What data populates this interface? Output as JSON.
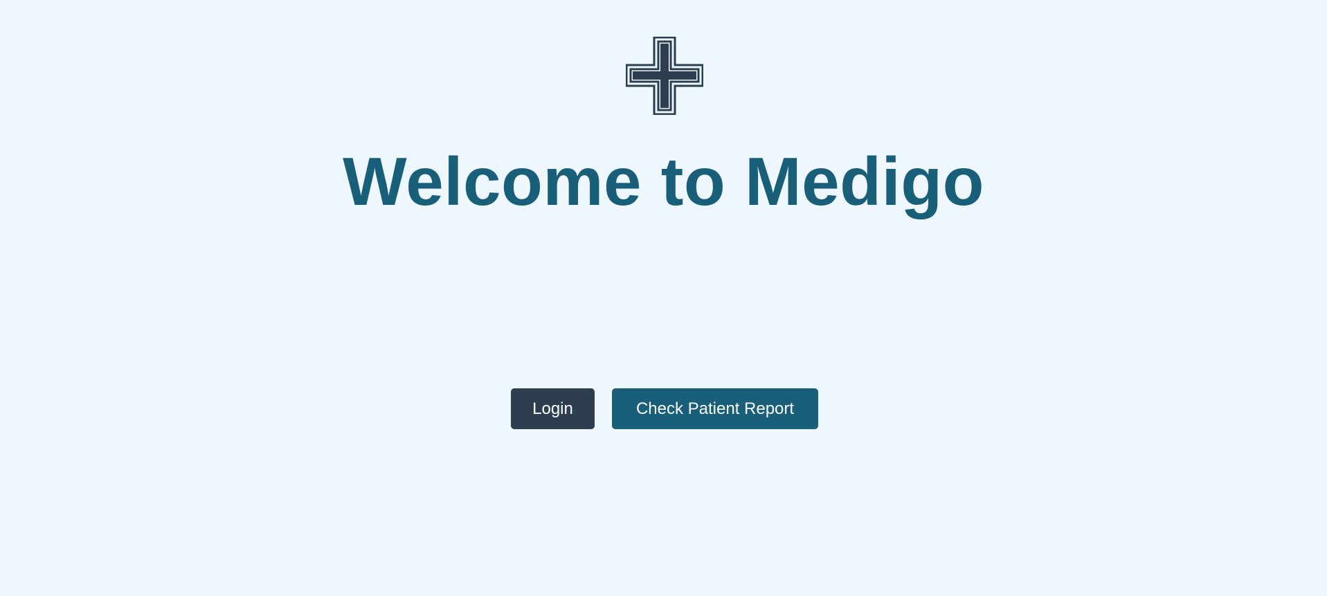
{
  "app": {
    "logo_icon": "medical-cross-icon",
    "title": "Welcome to Medigo"
  },
  "actions": {
    "login_label": "Login",
    "report_label": "Check Patient Report"
  },
  "colors": {
    "background": "#eef7fe",
    "title": "#1a5f7a",
    "login_button": "#2c3e50",
    "report_button": "#1a5f7a",
    "icon": "#2c3e50"
  }
}
